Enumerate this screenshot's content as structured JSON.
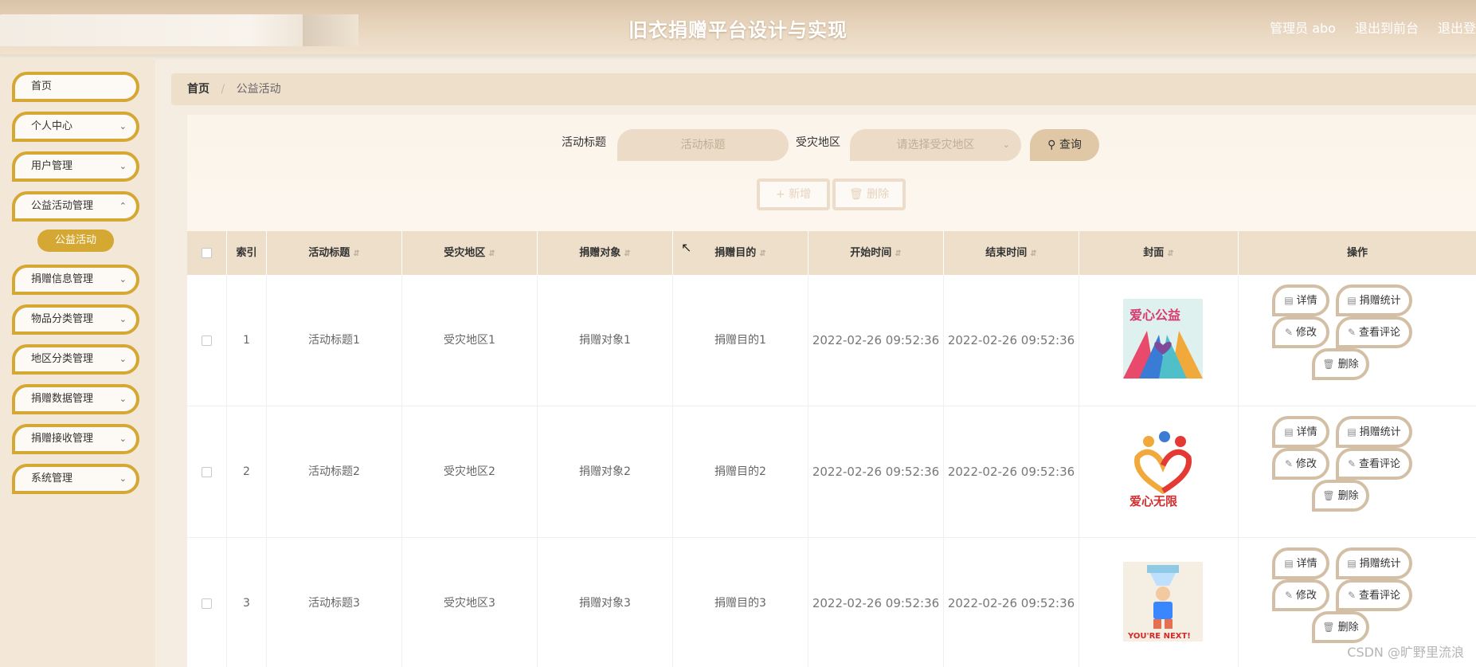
{
  "header": {
    "title": "旧衣捐赠平台设计与实现",
    "admin_label": "管理员 abo",
    "to_front": "退出到前台",
    "logout": "退出登"
  },
  "sidebar": {
    "items": [
      {
        "label": "首页",
        "expandable": false
      },
      {
        "label": "个人中心",
        "expandable": true
      },
      {
        "label": "用户管理",
        "expandable": true
      },
      {
        "label": "公益活动管理",
        "expandable": true
      },
      {
        "label": "捐赠信息管理",
        "expandable": true
      },
      {
        "label": "物品分类管理",
        "expandable": true
      },
      {
        "label": "地区分类管理",
        "expandable": true
      },
      {
        "label": "捐赠数据管理",
        "expandable": true
      },
      {
        "label": "捐赠接收管理",
        "expandable": true
      },
      {
        "label": "系统管理",
        "expandable": true
      }
    ],
    "active_sub": "公益活动"
  },
  "breadcrumb": {
    "home": "首页",
    "sep": "/",
    "current": "公益活动"
  },
  "search": {
    "title_label": "活动标题",
    "title_placeholder": "活动标题",
    "region_label": "受灾地区",
    "region_placeholder": "请选择受灾地区",
    "query_label": "查询"
  },
  "actions": {
    "add_label": "新增",
    "delete_label": "删除"
  },
  "table": {
    "headers": [
      "索引",
      "活动标题",
      "受灾地区",
      "捐赠对象",
      "捐赠目的",
      "开始时间",
      "结束时间",
      "封面",
      "操作"
    ],
    "rows": [
      {
        "index": "1",
        "title": "活动标题1",
        "region": "受灾地区1",
        "target": "捐赠对象1",
        "purpose": "捐赠目的1",
        "start": "2022-02-26 09:52:36",
        "end": "2022-02-26 09:52:36",
        "cover_text": "爱心公益"
      },
      {
        "index": "2",
        "title": "活动标题2",
        "region": "受灾地区2",
        "target": "捐赠对象2",
        "purpose": "捐赠目的2",
        "start": "2022-02-26 09:52:36",
        "end": "2022-02-26 09:52:36",
        "cover_text": "爱心无限"
      },
      {
        "index": "3",
        "title": "活动标题3",
        "region": "受灾地区3",
        "target": "捐赠对象3",
        "purpose": "捐赠目的3",
        "start": "2022-02-26 09:52:36",
        "end": "2022-02-26 09:52:36",
        "cover_text": "YOU'RE NEXT!"
      }
    ],
    "row_ops": {
      "detail": "详情",
      "stats": "捐赠统计",
      "edit": "修改",
      "comments": "查看评论",
      "delete": "删除"
    }
  },
  "watermark": "CSDN @旷野里流浪",
  "colors": {
    "accent": "#d4a832",
    "header_bg": "#e6d2ba",
    "table_header_bg": "#eedfca"
  }
}
